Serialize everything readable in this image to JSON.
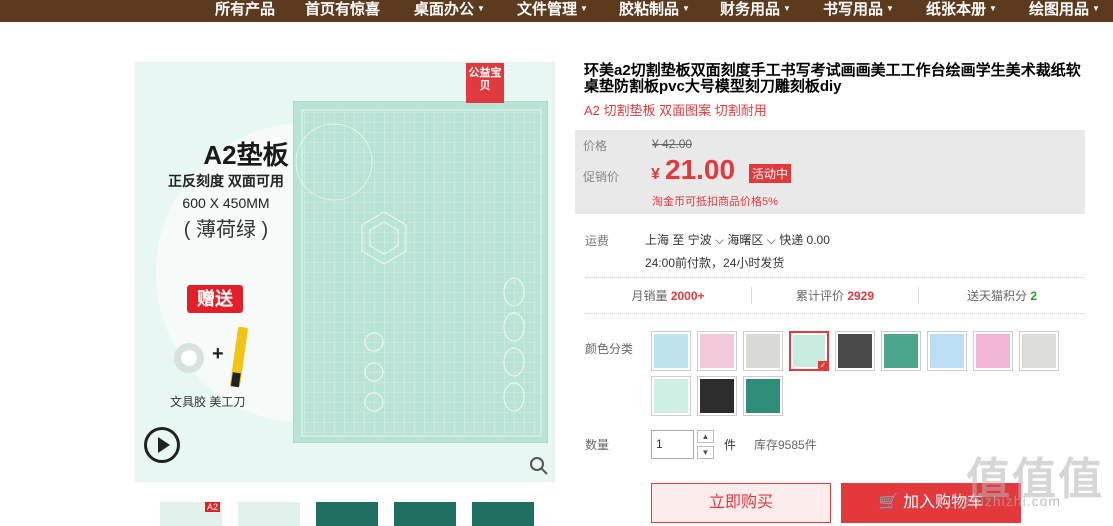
{
  "nav": {
    "items": [
      {
        "label": "所有产品",
        "caret": false
      },
      {
        "label": "首页有惊喜",
        "caret": false
      },
      {
        "label": "桌面办公",
        "caret": true
      },
      {
        "label": "文件管理",
        "caret": true
      },
      {
        "label": "胶粘制品",
        "caret": true
      },
      {
        "label": "财务用品",
        "caret": true
      },
      {
        "label": "书写用品",
        "caret": true
      },
      {
        "label": "纸张本册",
        "caret": true
      },
      {
        "label": "绘图用品",
        "caret": true
      }
    ]
  },
  "gallery": {
    "title": "A2垫板",
    "sub1": "正反刻度  双面可用",
    "sub2": "600 X 450MM",
    "sub3": "( 薄荷绿 )",
    "gift": "赠送",
    "gift_caption": "文具胶   美工刀",
    "public_badge": "公益宝贝",
    "play_icon": "play-icon",
    "zoom_icon": "zoom-icon"
  },
  "thumbs": [
    {
      "label": "A2",
      "dark": false
    },
    {
      "label": "",
      "dark": false
    },
    {
      "label": "",
      "dark": true
    },
    {
      "label": "",
      "dark": true
    },
    {
      "label": "",
      "dark": true
    }
  ],
  "product": {
    "title": "环美a2切割垫板双面刻度手工书写考试画画美工工作台绘画学生美术裁纸软桌垫防割板pvc大号模型刻刀雕刻板diy",
    "subtitle": "A2 切割垫板 双面图案 切割耐用"
  },
  "price": {
    "price_label": "价格",
    "original": "¥ 42.00",
    "promo_label": "促销价",
    "currency": "¥",
    "current": "21.00",
    "activity": "活动中",
    "coin_note": "淘金币可抵扣商品价格5%"
  },
  "shipping": {
    "label": "运费",
    "route": "上海  至 宁波 ⌵ 海曙区 ⌵  快递 0.00",
    "time": "24:00前付款，24小时发货"
  },
  "stats": {
    "monthly_label": "月销量",
    "monthly_value": "2000+",
    "reviews_label": "累计评价",
    "reviews_value": "2929",
    "points_label": "送天猫积分",
    "points_value": "2"
  },
  "colors": {
    "label": "颜色分类",
    "swatches": [
      "#bfe3ef",
      "#f3c9dc",
      "#d9d9d6",
      "#c9ece1",
      "#4b4b4b",
      "#4aa78e",
      "#bcdff5",
      "#f2b7d3",
      "#dcdcd8",
      "#cfeee4",
      "#2d2d2d",
      "#2e8e7a"
    ],
    "selected_index": 3
  },
  "quantity": {
    "label": "数量",
    "value": "1",
    "unit": "件",
    "stock": "库存9585件"
  },
  "actions": {
    "buy": "立即购买",
    "cart": "加入购物车"
  },
  "watermark": {
    "big": "值值值",
    "small": "zhizhizhi.com"
  }
}
